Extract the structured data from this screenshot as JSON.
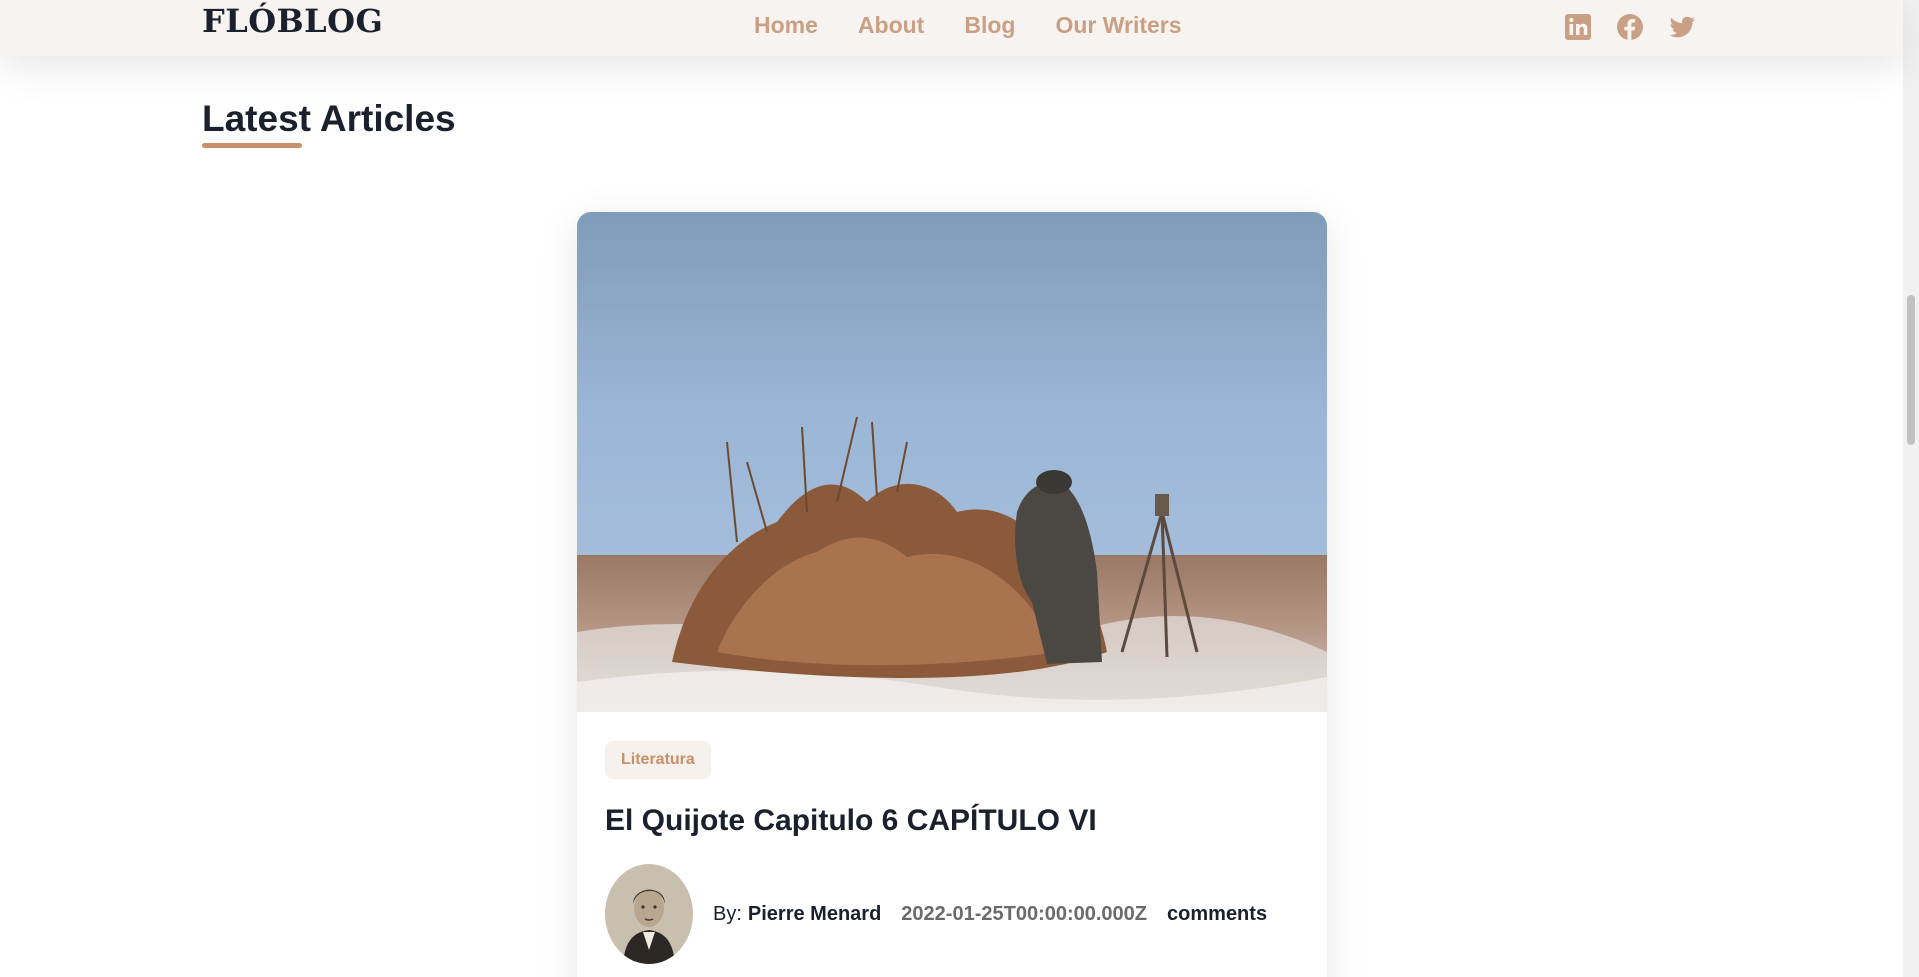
{
  "header": {
    "logo": "FLÓBLOG",
    "nav": [
      {
        "label": "Home"
      },
      {
        "label": "About"
      },
      {
        "label": "Blog"
      },
      {
        "label": "Our Writers"
      }
    ],
    "social_icons": [
      "linkedin-icon",
      "facebook-icon",
      "twitter-icon"
    ],
    "accent_color": "#c9a084",
    "background_color": "#f7f3f1"
  },
  "section": {
    "title": "Latest Articles",
    "underline_color": "#c98f66"
  },
  "article": {
    "category": "Literatura",
    "title": "El Quijote Capitulo 6 CAPÍTULO VI",
    "by_label": "By:",
    "author": "Pierre Menard",
    "date": "2022-01-25T00:00:00.000Z",
    "comments_label": "comments"
  }
}
